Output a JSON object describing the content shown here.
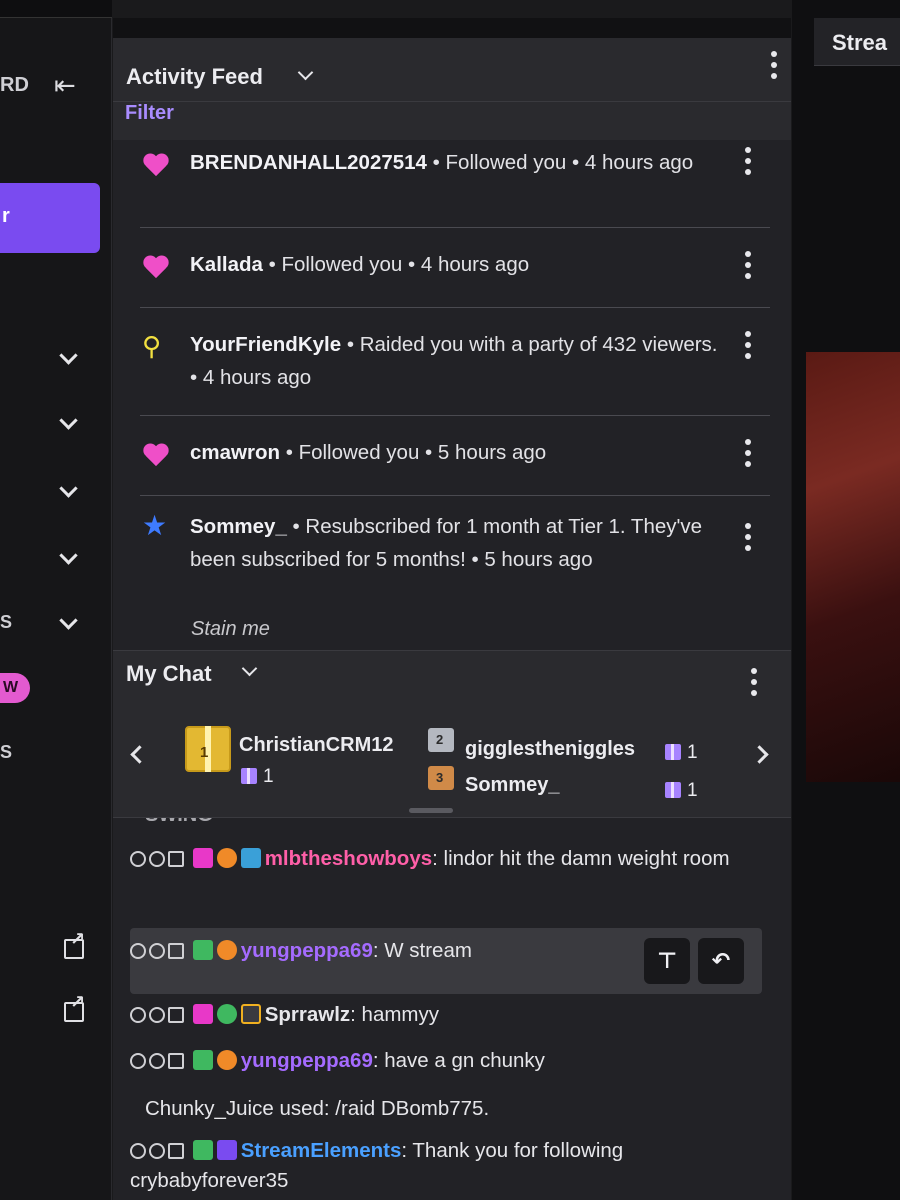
{
  "sidebar": {
    "partial_label": "RD",
    "active_partial": "r",
    "partial_s1": "S",
    "pill_label": "W",
    "partial_s2": "S"
  },
  "activity_feed": {
    "title": "Activity Feed",
    "filter_label": "Filter",
    "items": [
      {
        "user": "BRENDANHALL2027514",
        "text": " • Followed you • 4 hours ago",
        "icon": "heart-icon"
      },
      {
        "user": "Kallada",
        "text": " • Followed you • 4 hours ago",
        "icon": "heart-icon"
      },
      {
        "user": "YourFriendKyle",
        "text": " • Raided you with a party of 432 viewers. • 4 hours ago",
        "icon": "raid-icon"
      },
      {
        "user": "cmawron",
        "text": " • Followed you • 5 hours ago",
        "icon": "heart-icon"
      },
      {
        "user": "Sommey_",
        "text": " • Resubscribed for 1 month at Tier 1. They've been subscribed for 5 months! • 5 hours ago",
        "icon": "star-icon"
      }
    ],
    "resub_message": "Stain me"
  },
  "my_chat": {
    "title": "My Chat",
    "gifters": [
      {
        "rank": "1",
        "name": "ChristianCRM12",
        "count": "1"
      },
      {
        "rank": "2",
        "name": "gigglestheniggles",
        "count": "1"
      },
      {
        "rank": "3",
        "name": "Sommey_",
        "count": "1"
      }
    ],
    "cut_text": "SWING",
    "messages": [
      {
        "user": "mlbtheshowboys",
        "text": ": lindor hit the damn weight room",
        "color": "#ff5fa8"
      },
      {
        "user": "yungpeppa69",
        "text": ": W stream",
        "color": "#a56bff"
      },
      {
        "user": "Sprrawlz",
        "text": ": hammyy",
        "color": "#e6e6ea"
      },
      {
        "user": "yungpeppa69",
        "text": ": have a gn chunky",
        "color": "#a56bff"
      },
      {
        "system": "Chunky_Juice used: /raid DBomb775."
      },
      {
        "user": "StreamElements",
        "text": ": Thank you for following crybabyforever35",
        "color": "#4aa0ff"
      }
    ],
    "pin_icon": "pin-icon",
    "reply_icon": "reply-icon"
  },
  "right_panel": {
    "title_partial": "Strea"
  },
  "colors": {
    "accent": "#7a4bf0",
    "follow_heart": "#ef4fc8",
    "raid": "#f2e040",
    "sub_star": "#3e7bff"
  }
}
